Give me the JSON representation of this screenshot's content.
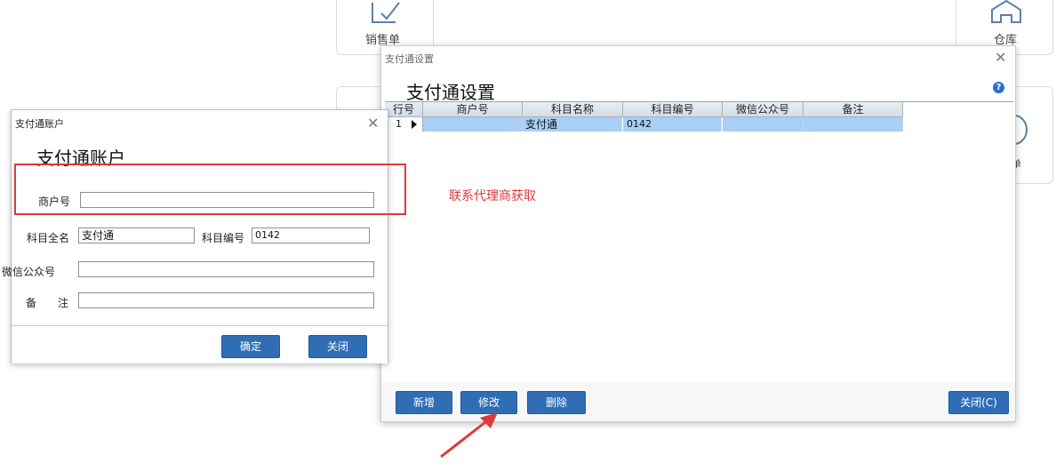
{
  "background": {
    "tile1_label": "销售单",
    "tile2_label": "仓库",
    "tile3_label": "单"
  },
  "main_dialog": {
    "window_title": "支付通设置",
    "heading": "支付通设置",
    "help_glyph": "?",
    "close_glyph": "✕",
    "columns": [
      "行号",
      "商户号",
      "科目名称",
      "科目编号",
      "微信公众号",
      "备注"
    ],
    "rows": [
      {
        "row_no": "1",
        "merchant_no": "",
        "account_name": "支付通",
        "account_code": "0142",
        "wechat": "",
        "note": ""
      }
    ],
    "buttons": {
      "add": "新增",
      "edit": "修改",
      "delete": "删除",
      "close": "关闭(C)"
    }
  },
  "annotation": {
    "note": "联系代理商获取",
    "color": "#e0393b"
  },
  "left_dialog": {
    "window_title": "支付通账户",
    "heading": "支付通账户",
    "close_glyph": "✕",
    "fields": {
      "merchant_no_label": "商户号",
      "merchant_no_value": "",
      "account_fullname_label": "科目全名",
      "account_fullname_value": "支付通",
      "account_code_label": "科目编号",
      "account_code_value": "0142",
      "wechat_label": "微信公众号",
      "wechat_value": "",
      "note_label": "备　注",
      "note_value": ""
    },
    "buttons": {
      "confirm": "确定",
      "close": "关闭"
    }
  },
  "colors": {
    "button_blue": "#2f6db5",
    "row_selected": "#a8cff5",
    "accent_red": "#e0393b"
  }
}
